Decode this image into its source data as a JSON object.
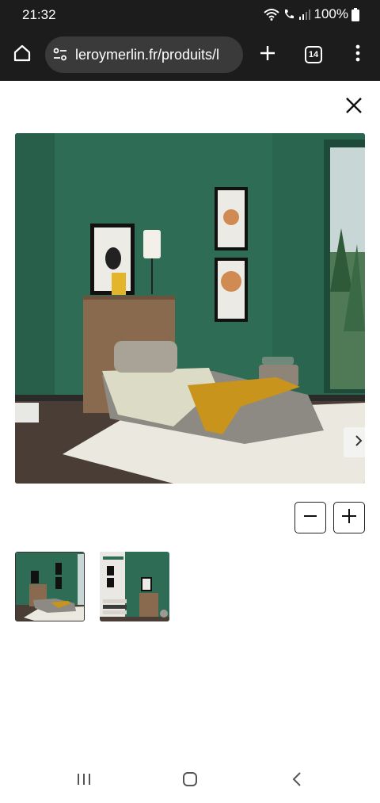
{
  "status_bar": {
    "time": "21:32",
    "battery": "100%"
  },
  "browser": {
    "url": "leroymerlin.fr/produits/l",
    "tab_count": "14"
  },
  "gallery": {
    "thumbnails": [
      "bedroom-bed-view",
      "cabinet-closed-view"
    ],
    "selected_index": 0
  },
  "colors": {
    "wall_green": "#2f6c56",
    "bar_dark": "#1c1c1c"
  }
}
